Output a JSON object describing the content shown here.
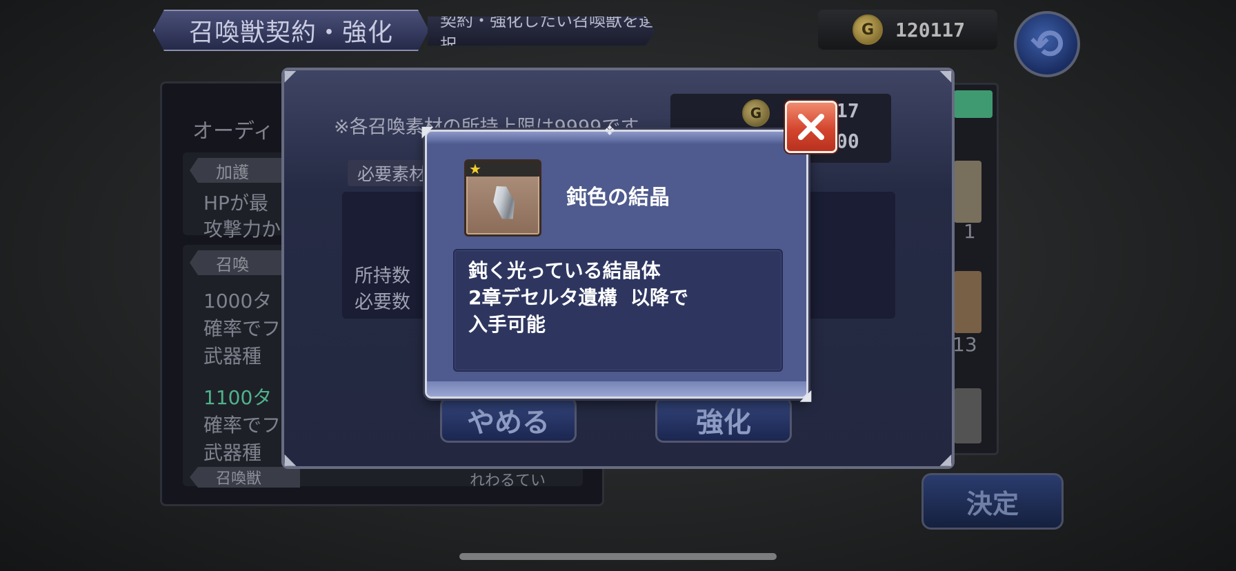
{
  "header": {
    "title": "召喚獣契約・強化",
    "subtitle": "契約・強化したい召喚獣を選択",
    "gold_icon": "G",
    "gold": "120117"
  },
  "left_panel": {
    "name": "オーディ",
    "section1_label": "加護",
    "section1_line1": "HPが最",
    "section1_line2": "攻撃力か",
    "section2_label": "召喚",
    "line_a1": "1000タ",
    "line_a2": "確率でフ",
    "line_a3": "武器種",
    "line_b1": "1100タ",
    "line_b2": "確率でフ",
    "line_b3": "武器種",
    "bottom_label": "召喚獣",
    "bottom_right": "れわるてい"
  },
  "right_panel": {
    "count_1": "1",
    "count_2": "13"
  },
  "mid_dialog": {
    "note": "※各召喚素材の所持上限は9999です",
    "required_materials_label": "必要素材",
    "owned_label": "所持数",
    "required_label": "必要数",
    "gold_icon": "G",
    "gold_line1": "17",
    "gold_line2": "00",
    "cancel_label": "やめる",
    "enhance_label": "強化"
  },
  "decide_label": "決定",
  "item_popup": {
    "item_name": "鈍色の結晶",
    "rarity_stars": 1,
    "description_lines": [
      "鈍く光っている結晶体",
      "2章デセルタ遺構  以降で",
      "入手可能"
    ]
  },
  "colors": {
    "close_button": "#d4452e",
    "popup_body": "#4f5b8e",
    "accent_green": "#4fb38a"
  }
}
